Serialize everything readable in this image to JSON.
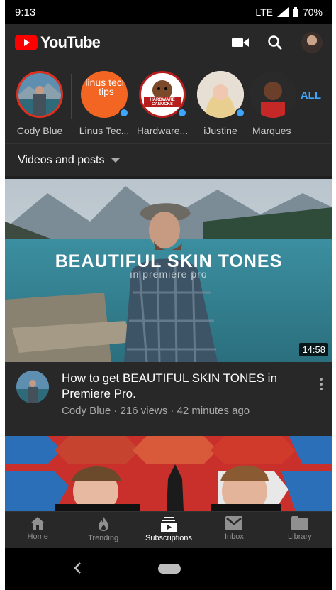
{
  "status_bar": {
    "time": "9:13",
    "network": "LTE",
    "battery": "70%"
  },
  "app_bar": {
    "logo_text": "YouTube",
    "brand_color": "#ff0000",
    "icons": [
      "video-camera-icon",
      "search-icon",
      "account-avatar"
    ]
  },
  "subscriptions": {
    "channels": [
      {
        "name": "Cody Blue",
        "selected": true,
        "new": false
      },
      {
        "name": "Linus Tec...",
        "selected": false,
        "new": true,
        "logo_text": "linus tech tips"
      },
      {
        "name": "Hardware...",
        "selected": false,
        "new": true,
        "logo_text": "HARDWARE CANUCKS"
      },
      {
        "name": "iJustine",
        "selected": false,
        "new": true
      },
      {
        "name": "Marques",
        "selected": false,
        "new": false
      }
    ],
    "all_label": "ALL"
  },
  "filter": {
    "label": "Videos and posts"
  },
  "videos": [
    {
      "thumbnail_title": "BEAUTIFUL SKIN TONES",
      "thumbnail_subtitle": "in premiere pro",
      "duration": "14:58",
      "title": "How to get BEAUTIFUL SKIN TONES in Premiere Pro.",
      "meta": "Cody Blue · 216 views · 42 minutes ago"
    }
  ],
  "bottom_nav": [
    {
      "label": "Home",
      "icon": "home-icon",
      "active": false
    },
    {
      "label": "Trending",
      "icon": "flame-icon",
      "active": false
    },
    {
      "label": "Subscriptions",
      "icon": "subscriptions-icon",
      "active": true
    },
    {
      "label": "Inbox",
      "icon": "inbox-icon",
      "active": false
    },
    {
      "label": "Library",
      "icon": "folder-icon",
      "active": false
    }
  ],
  "colors": {
    "accent_blue": "#3ea6ff",
    "background": "#1f1f1f",
    "surface": "#282828"
  }
}
